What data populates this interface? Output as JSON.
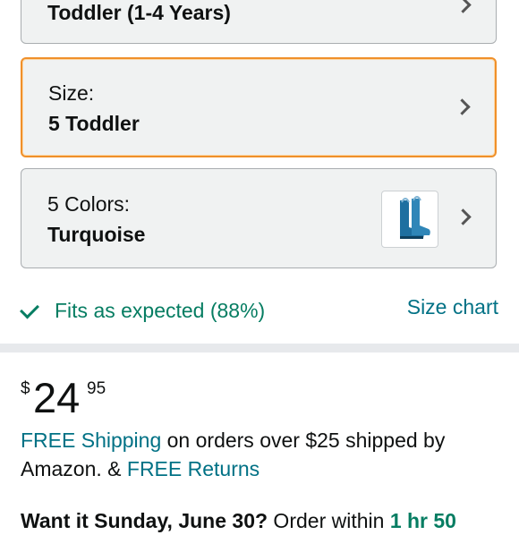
{
  "style_selector": {
    "value": "Toddler (1-4 Years)"
  },
  "size_selector": {
    "label": "Size:",
    "value": "5 Toddler"
  },
  "color_selector": {
    "label": "5 Colors:",
    "value": "Turquoise",
    "thumbnail_icon": "rain-boot-icon",
    "thumbnail_color": "#1e6fa0"
  },
  "fit": {
    "icon": "check-icon",
    "text": "Fits as expected (88%)",
    "size_chart_link": "Size chart"
  },
  "price": {
    "symbol": "$",
    "whole": "24",
    "fraction": "95"
  },
  "shipping": {
    "free_shipping_link": "FREE Shipping",
    "text_1": " on orders over $25 shipped by Amazon. & ",
    "free_returns_link": "FREE Returns"
  },
  "delivery": {
    "prefix": "Want it Sunday, June 30?",
    "text": " Order within ",
    "countdown": "1 hr 50"
  },
  "colors": {
    "link": "#007185",
    "success_green": "#067d62",
    "selected_border": "#f0902a",
    "selector_bg": "#f0f2f2"
  }
}
